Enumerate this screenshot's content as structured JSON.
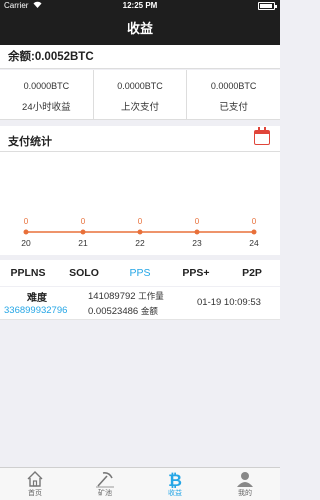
{
  "status_bar": {
    "carrier": "Carrier",
    "time": "12:25 PM",
    "battery_level": 0.95
  },
  "nav": {
    "title": "收益"
  },
  "balance": {
    "text": "余额:0.0052BTC"
  },
  "stats": [
    {
      "value": "0.0000BTC",
      "label": "24小时收益"
    },
    {
      "value": "0.0000BTC",
      "label": "上次支付"
    },
    {
      "value": "0.0000BTC",
      "label": "已支付"
    }
  ],
  "pay_section": {
    "title": "支付统计",
    "calendar_icon": "calendar-icon"
  },
  "chart_data": {
    "type": "line",
    "x": [
      "20",
      "21",
      "22",
      "23",
      "24"
    ],
    "values": [
      0,
      0,
      0,
      0,
      0
    ],
    "data_labels": [
      "0",
      "0",
      "0",
      "0",
      "0"
    ],
    "color": "#e8703a",
    "grid": false
  },
  "tabs": [
    {
      "label": "PPLNS"
    },
    {
      "label": "SOLO"
    },
    {
      "label": "PPS",
      "active": true
    },
    {
      "label": "PPS+"
    },
    {
      "label": "P2P"
    }
  ],
  "record": {
    "header": "难度",
    "address": "336899932796",
    "work_value": "141089792",
    "work_unit": "工作量",
    "amount_value": "0.00523486",
    "amount_unit": "金额",
    "time": "01-19 10:09:53"
  },
  "tabbar": [
    {
      "label": "首页",
      "icon": "home-icon"
    },
    {
      "label": "矿池",
      "icon": "pickaxe-icon"
    },
    {
      "label": "收益",
      "icon": "bitcoin-icon",
      "active": true
    },
    {
      "label": "我的",
      "icon": "user-icon"
    }
  ],
  "colors": {
    "accent": "#25a6e6",
    "chart_line": "#e8703a",
    "calendar": "#e0453a",
    "nav_bg": "#1e1e1e"
  }
}
